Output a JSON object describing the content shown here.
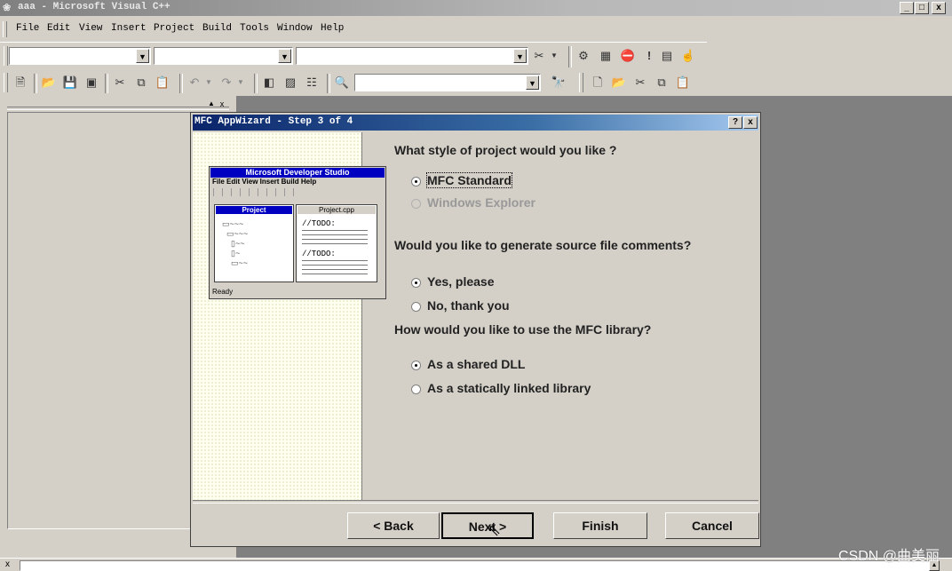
{
  "window": {
    "title": "aaa - Microsoft Visual C++",
    "controls": {
      "minimize": "_",
      "maximize": "□",
      "close": "x"
    }
  },
  "menu": [
    "File",
    "Edit",
    "View",
    "Insert",
    "Project",
    "Build",
    "Tools",
    "Window",
    "Help"
  ],
  "dialog": {
    "title": "MFC AppWizard - Step 3 of 4",
    "help": "?",
    "close": "x",
    "illustration": {
      "app_title": "Microsoft Developer Studio",
      "menu": "File Edit View Insert Build Help",
      "project_label": "Project",
      "file_label": "Project.cpp",
      "todo1": "//TODO:",
      "todo2": "//TODO:",
      "status": "Ready"
    },
    "q1": "What style of project would you like ?",
    "q1_options": [
      "MFC Standard",
      "Windows Explorer"
    ],
    "q2": "Would you like to generate source file comments?",
    "q2_options": [
      "Yes, please",
      "No, thank you"
    ],
    "q3": "How would you like to use the MFC library?",
    "q3_options": [
      "As a shared DLL",
      "As a statically linked library"
    ],
    "buttons": {
      "back": "< Back",
      "next": "Next >",
      "finish": "Finish",
      "cancel": "Cancel"
    }
  },
  "watermark": "CSDN @曲美丽"
}
